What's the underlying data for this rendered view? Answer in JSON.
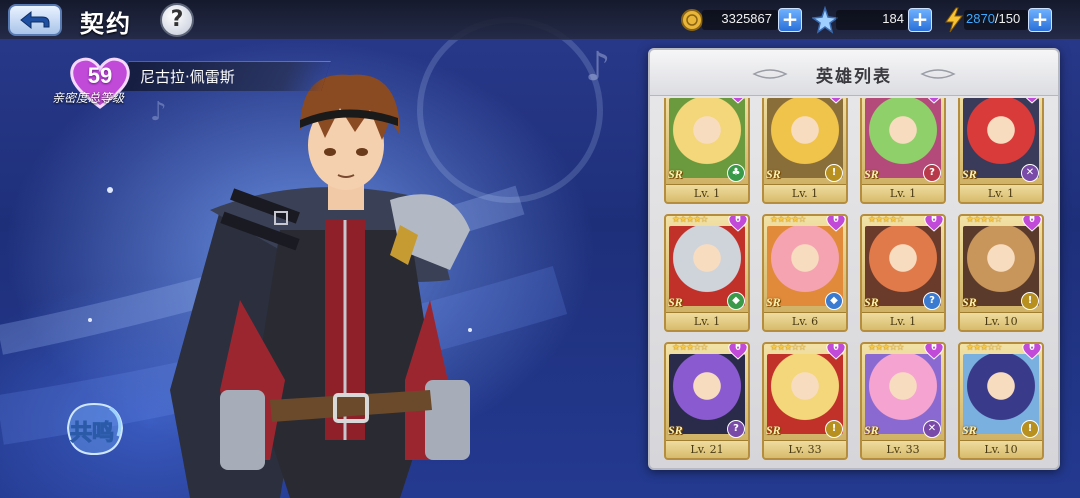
{
  "header": {
    "title": "契约",
    "help_label": "?"
  },
  "resources": {
    "gold": {
      "value": "3325867",
      "icon": "gold-coin-icon"
    },
    "crystal": {
      "value": "184",
      "icon": "crystal-star-icon"
    },
    "stamina": {
      "current": "2870",
      "max": "/150",
      "icon": "lightning-icon"
    },
    "plus_label": "+"
  },
  "colors": {
    "stamina_current": "#3fa9ff",
    "accent_blue": "#2a6fd8",
    "affinity_heart": "#c24ad8"
  },
  "affinity": {
    "level": "59",
    "hero_name": "尼古拉·佩雷斯",
    "caption": "亲密度总等级"
  },
  "resonance": {
    "label": "共鸣"
  },
  "panel": {
    "title": "英雄列表",
    "heroes": [
      {
        "rarity": "SR",
        "level": "Lv. 1",
        "hearts": "0",
        "stars": 5,
        "class_icon": "clover-icon",
        "class_color": "#3b9a4a",
        "palette": [
          "#f3d77a",
          "#6b9a3e"
        ]
      },
      {
        "rarity": "SR",
        "level": "Lv. 1",
        "hearts": "0",
        "stars": 5,
        "class_icon": "exclamation-icon",
        "class_color": "#b7901f",
        "palette": [
          "#f0c34a",
          "#8a6e3a"
        ]
      },
      {
        "rarity": "SR",
        "level": "Lv. 1",
        "hearts": "0",
        "stars": 5,
        "class_icon": "question-icon",
        "class_color": "#b83a4a",
        "palette": [
          "#8fd06a",
          "#b44a7a"
        ]
      },
      {
        "rarity": "SR",
        "level": "Lv. 1",
        "hearts": "0",
        "stars": 5,
        "class_icon": "swords-icon",
        "class_color": "#7a4aa8",
        "palette": [
          "#d93a3a",
          "#3a3a5a"
        ]
      },
      {
        "rarity": "SR",
        "level": "Lv. 1",
        "hearts": "0",
        "stars": 4,
        "class_icon": "shield-icon",
        "class_color": "#3b9a4a",
        "palette": [
          "#cfd3da",
          "#c2302a"
        ]
      },
      {
        "rarity": "SR",
        "level": "Lv. 6",
        "hearts": "0",
        "stars": 4,
        "class_icon": "shield-icon",
        "class_color": "#3a7ad0",
        "palette": [
          "#f5a3b0",
          "#e08a3a"
        ]
      },
      {
        "rarity": "SR",
        "level": "Lv. 1",
        "hearts": "0",
        "stars": 4,
        "class_icon": "question-icon",
        "class_color": "#3a7ad0",
        "palette": [
          "#e07a4a",
          "#6a3a2a"
        ]
      },
      {
        "rarity": "SR",
        "level": "Lv. 10",
        "hearts": "0",
        "stars": 4,
        "class_icon": "exclamation-icon",
        "class_color": "#b7901f",
        "palette": [
          "#c8955a",
          "#5a3a2a"
        ]
      },
      {
        "rarity": "SR",
        "level": "Lv. 21",
        "hearts": "0",
        "stars": 3,
        "class_icon": "question-icon",
        "class_color": "#7a4aa8",
        "palette": [
          "#8a5ad0",
          "#2a2a4a"
        ]
      },
      {
        "rarity": "SR",
        "level": "Lv. 33",
        "hearts": "0",
        "stars": 3,
        "class_icon": "exclamation-icon",
        "class_color": "#b7901f",
        "palette": [
          "#f3d77a",
          "#c2302a"
        ]
      },
      {
        "rarity": "SR",
        "level": "Lv. 33",
        "hearts": "0",
        "stars": 3,
        "class_icon": "swords-icon",
        "class_color": "#7a4aa8",
        "palette": [
          "#f5a3d0",
          "#8a6ad0"
        ]
      },
      {
        "rarity": "SR",
        "level": "Lv. 10",
        "hearts": "0",
        "stars": 3,
        "class_icon": "exclamation-icon",
        "class_color": "#b7901f",
        "palette": [
          "#3a3a8a",
          "#7ab0e0"
        ]
      }
    ]
  }
}
